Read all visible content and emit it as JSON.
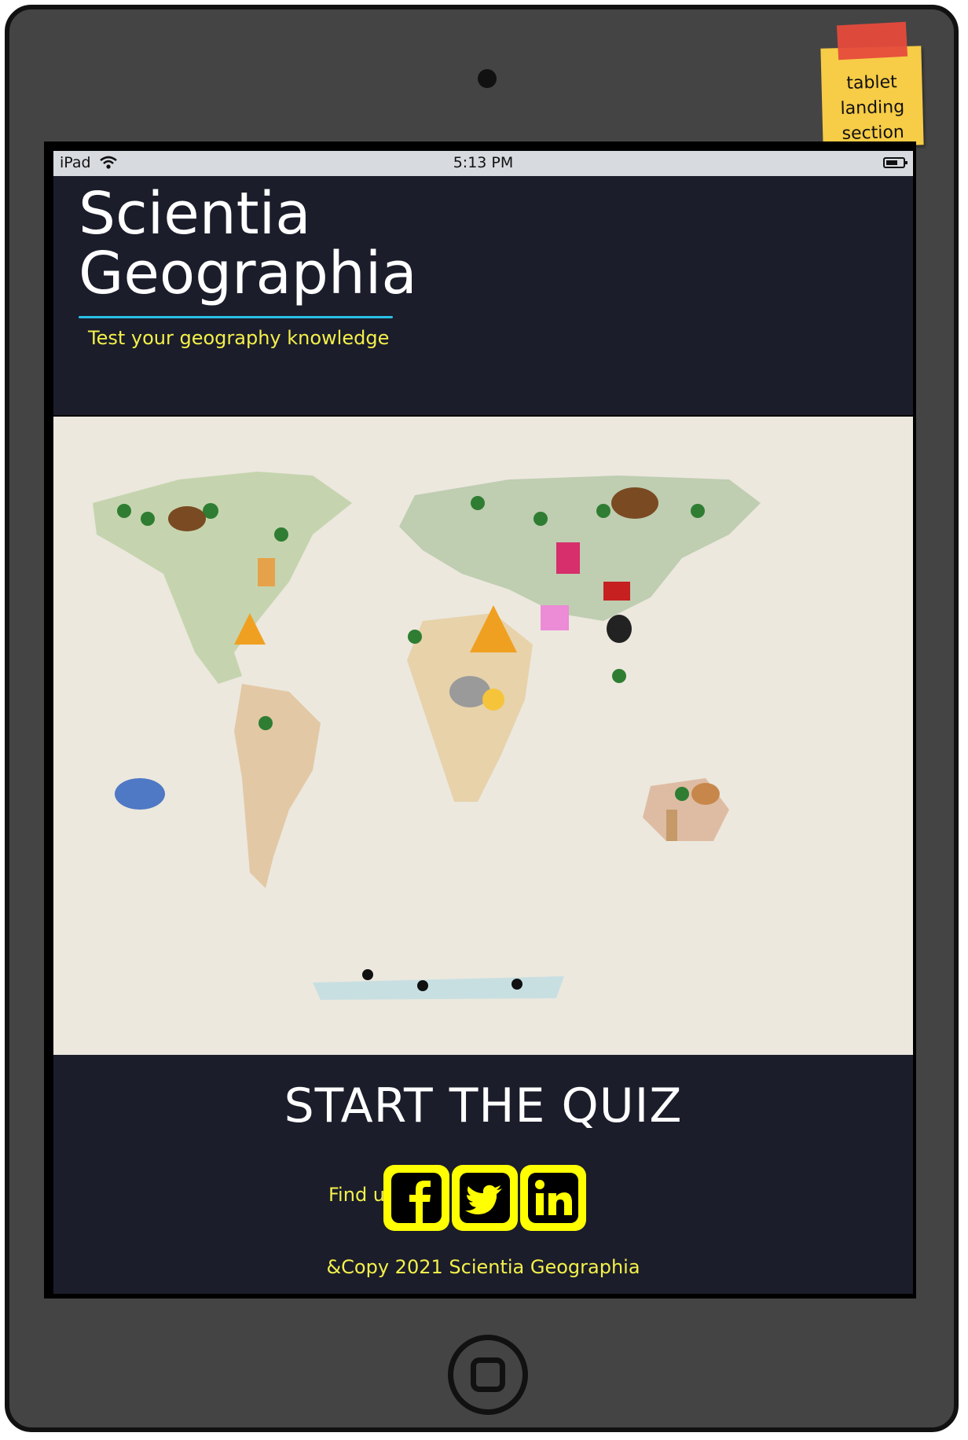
{
  "sticky_note": {
    "line1": "tablet",
    "line2": "landing",
    "line3": "section"
  },
  "status_bar": {
    "device": "iPad",
    "time": "5:13 PM"
  },
  "header": {
    "title_line1": "Scientia",
    "title_line2": "Geographia",
    "subtitle": "Test your geography knowledge"
  },
  "footer": {
    "cta": "START THE QUIZ",
    "find_us": "Find us on",
    "copyright": "&Copy 2021 Scientia Geographia"
  },
  "social": [
    {
      "icon": "facebook-icon"
    },
    {
      "icon": "twitter-icon"
    },
    {
      "icon": "linkedin-icon"
    }
  ],
  "colors": {
    "accent_yellow": "#f3f04a",
    "social_yellow": "#ffff00",
    "header_bg": "#1b1d2b",
    "underline": "#29c1e8"
  }
}
